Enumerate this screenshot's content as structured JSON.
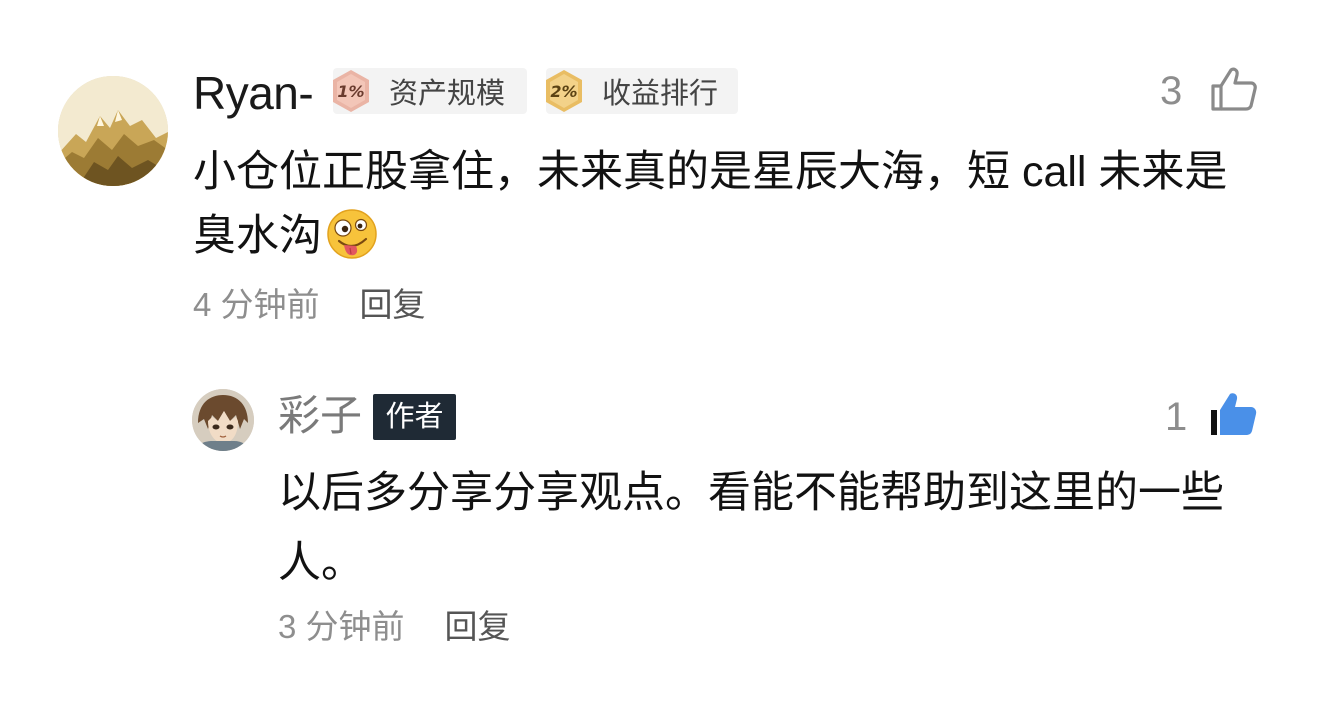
{
  "main_comment": {
    "username": "Ryan-",
    "badges": [
      {
        "icon": "1%",
        "label": "资产规模",
        "color": "#e8b3a4"
      },
      {
        "icon": "2%",
        "label": "收益排行",
        "color": "#ecc77a"
      }
    ],
    "like_count": "3",
    "liked": false,
    "content": "小仓位正股拿住，未来真的是星辰大海，短 call 未来是臭水沟",
    "emoji": "zany-face",
    "time": "4 分钟前",
    "reply_label": "回复"
  },
  "reply_comment": {
    "username": "彩子",
    "author_tag": "作者",
    "like_count": "1",
    "liked": true,
    "content": "以后多分享分享观点。看能不能帮助到这里的一些人。",
    "time": "3 分钟前",
    "reply_label": "回复"
  },
  "colors": {
    "liked_blue": "#4a90e8",
    "muted_text": "#8e8e8e",
    "author_tag_bg": "#1f2a35"
  }
}
